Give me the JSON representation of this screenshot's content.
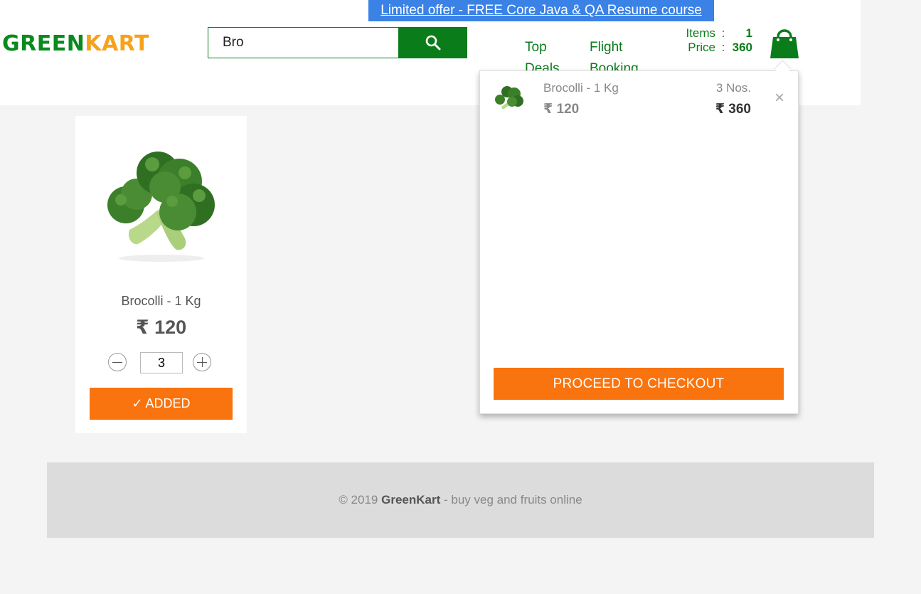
{
  "promo": {
    "text": "Limited offer - FREE Core Java & QA Resume course"
  },
  "brand": {
    "part1": "GREEN",
    "part2": "KART",
    "color_primary": "#0a8a1e",
    "color_accent": "#f7a21b"
  },
  "search": {
    "value": "Bro",
    "button_icon": "search-icon"
  },
  "nav": {
    "top_deals": "Top Deals",
    "flight_booking": "Flight Booking"
  },
  "cart_summary": {
    "items_label": "Items",
    "items_value": "1",
    "price_label": "Price",
    "price_value": "360",
    "separator": ":",
    "icon": "shopping-bag-icon"
  },
  "product": {
    "name": "Brocolli - 1 Kg",
    "price": "₹ 120",
    "quantity": "3",
    "button_label": "✓ ADDED",
    "image": "broccoli"
  },
  "cart_preview": {
    "items": [
      {
        "name": "Brocolli - 1 Kg",
        "price": "₹ 120",
        "quantity": "3 Nos.",
        "amount": "₹ 360",
        "remove": "×"
      }
    ],
    "checkout_label": "PROCEED TO CHECKOUT"
  },
  "footer": {
    "copyright": "© 2019",
    "brand": "GreenKart",
    "tagline": "- buy veg and fruits online"
  },
  "colors": {
    "green": "#0a7c1a",
    "orange": "#f9730e",
    "promo_bg": "#3b82e6"
  }
}
